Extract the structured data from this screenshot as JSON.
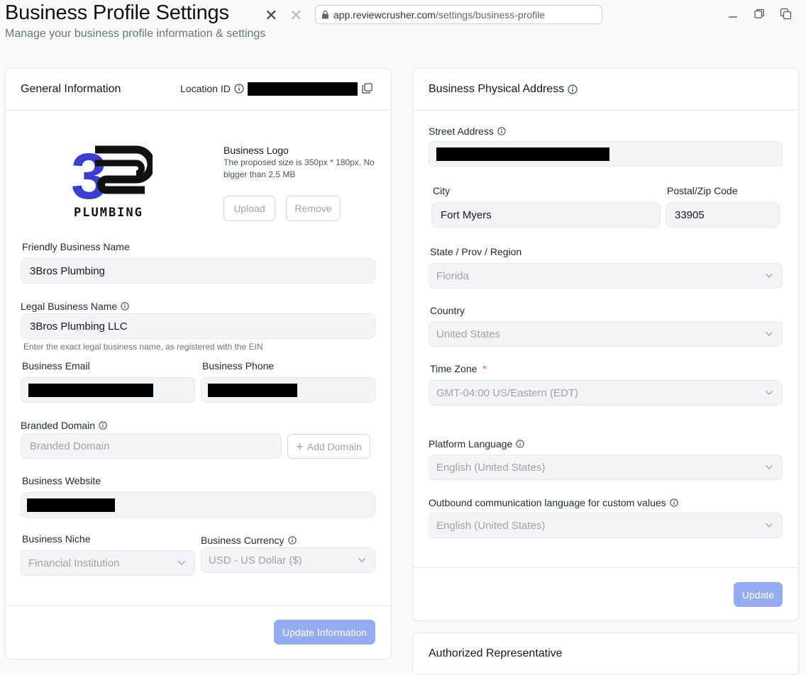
{
  "header": {
    "title": "Business Profile Settings",
    "subtitle": "Manage your business profile information & settings"
  },
  "browser": {
    "url_domain": "app.reviewcrusher.com",
    "url_path": "/settings/business-profile"
  },
  "general": {
    "title": "General Information",
    "location_id_label": "Location ID",
    "logo_text": "PLUMBING",
    "logo_number": "3",
    "logo_title": "Business Logo",
    "logo_hint_line1": "The proposed size is 350px * 180px. No",
    "logo_hint_line2": "bigger than 2.5 MB",
    "upload_label": "Upload",
    "remove_label": "Remove",
    "friendly_name_label": "Friendly Business Name",
    "friendly_name_value": "3Bros Plumbing",
    "legal_name_label": "Legal Business Name",
    "legal_name_value": "3Bros Plumbing LLC",
    "legal_name_hint": "Enter the exact legal business name, as registered with the EIN",
    "email_label": "Business Email",
    "phone_label": "Business Phone",
    "domain_label": "Branded Domain",
    "domain_placeholder": "Branded Domain",
    "add_domain_label": "Add Domain",
    "website_label": "Business Website",
    "niche_label": "Business Niche",
    "niche_value": "Financial Institution",
    "currency_label": "Business Currency",
    "currency_value": "USD - US Dollar ($)",
    "update_label": "Update Information"
  },
  "address": {
    "title": "Business Physical Address",
    "street_label": "Street Address",
    "city_label": "City",
    "city_value": "Fort Myers",
    "zip_label": "Postal/Zip Code",
    "zip_value": "33905",
    "state_label": "State / Prov / Region",
    "state_value": "Florida",
    "country_label": "Country",
    "country_value": "United States",
    "timezone_label": "Time Zone",
    "timezone_required": "*",
    "timezone_value": "GMT-04:00 US/Eastern (EDT)",
    "platform_lang_label": "Platform Language",
    "platform_lang_value": "English (United States)",
    "outbound_lang_label": "Outbound communication language for custom values",
    "outbound_lang_value": "English (United States)",
    "update_label": "Update"
  },
  "representative": {
    "title": "Authorized Representative"
  },
  "colors": {
    "primary_button": "#93acf0",
    "logo_blue": "#3b3fd1",
    "logo_black": "#111111"
  }
}
